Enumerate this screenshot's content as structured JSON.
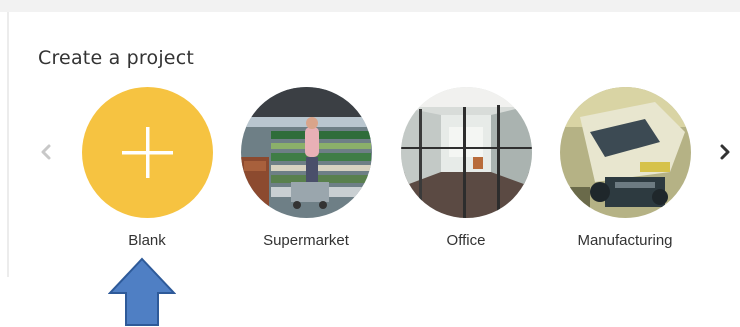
{
  "section_title": "Create a project",
  "nav": {
    "prev_icon": "chevron-left-icon",
    "next_icon": "chevron-right-icon"
  },
  "templates": [
    {
      "label": "Blank",
      "icon": "plus-icon",
      "color": "#f6c341"
    },
    {
      "label": "Supermarket"
    },
    {
      "label": "Office"
    },
    {
      "label": "Manufacturing"
    }
  ],
  "colors": {
    "accent": "#f6c341",
    "annotation_arrow": "#4f7fc4",
    "annotation_border": "#2e5a99"
  }
}
